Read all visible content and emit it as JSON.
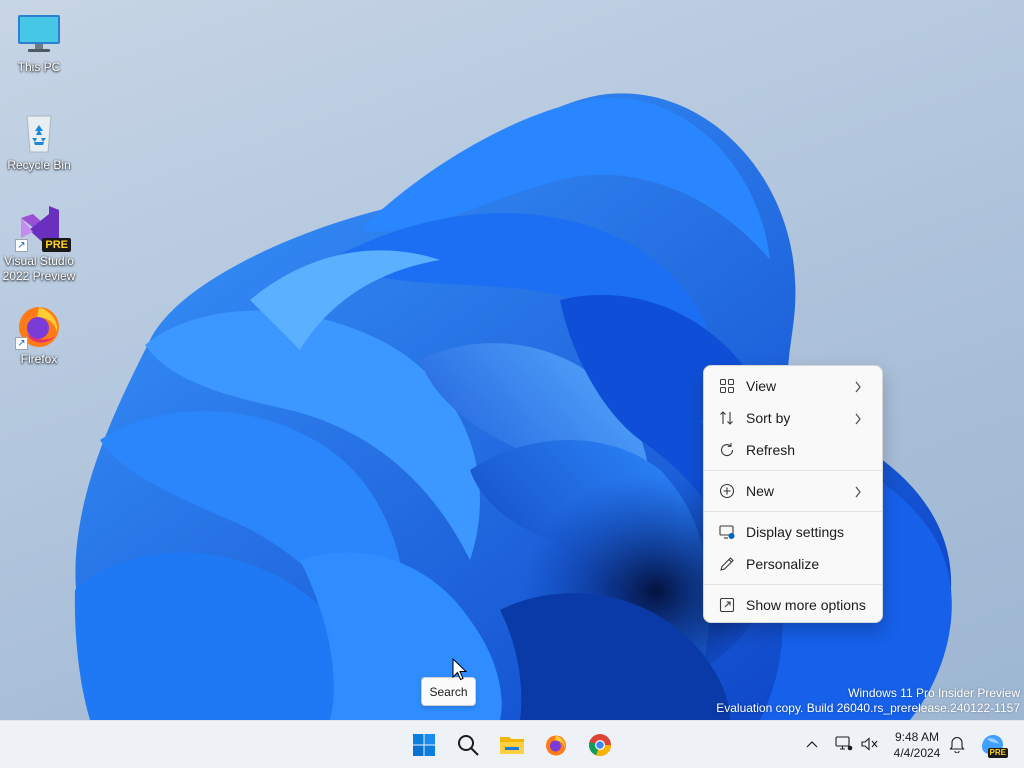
{
  "desktop": {
    "icons": [
      {
        "label": "This PC"
      },
      {
        "label": "Recycle Bin"
      },
      {
        "label": "Visual Studio 2022 Preview",
        "badge": "PRE"
      },
      {
        "label": "Firefox"
      }
    ],
    "watermark": {
      "line1": "Windows 11 Pro Insider Preview",
      "line2": "Evaluation copy. Build 26040.rs_prerelease.240122-1157"
    }
  },
  "context_menu": {
    "items": [
      {
        "label": "View",
        "icon": "grid-icon",
        "submenu": true
      },
      {
        "label": "Sort by",
        "icon": "sort-icon",
        "submenu": true
      },
      {
        "label": "Refresh",
        "icon": "refresh-icon",
        "submenu": false
      },
      {
        "label": "New",
        "icon": "plus-circle-icon",
        "submenu": true
      },
      {
        "label": "Display settings",
        "icon": "display-settings-icon",
        "submenu": false
      },
      {
        "label": "Personalize",
        "icon": "pen-icon",
        "submenu": false
      },
      {
        "label": "Show more options",
        "icon": "show-more-icon",
        "submenu": false
      }
    ]
  },
  "tooltip": {
    "text": "Search"
  },
  "taskbar": {
    "apps": [
      "start-icon",
      "search-icon",
      "file-explorer-icon",
      "firefox-icon",
      "chrome-icon"
    ],
    "tray": [
      "chevron-up-icon",
      "network-icon",
      "volume-muted-icon",
      "notification-bell-icon",
      "copilot-icon"
    ],
    "clock": {
      "time": "9:48 AM",
      "date": "4/4/2024"
    },
    "copilot_badge": "PRE"
  },
  "colors": {
    "accent": "#0067c0",
    "wallpaper_blue": "#1a6df0",
    "menu_bg": "#f9f9f9",
    "taskbar_bg": "#eef1f6"
  }
}
